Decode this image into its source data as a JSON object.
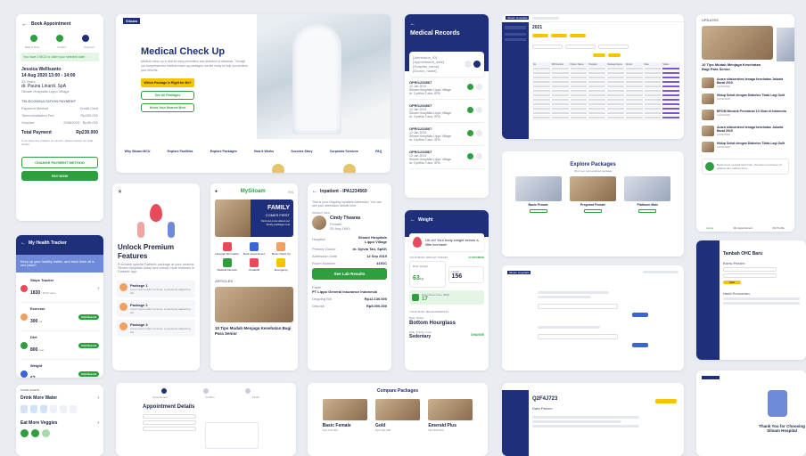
{
  "booking": {
    "title": "Book Appointment",
    "steps": [
      "Date & Time",
      "Confirm",
      "Payment"
    ],
    "banner": "You have 2 MCU to claim your selected date",
    "patient": "Jessica Wellisanto",
    "date": "14 Aug 2020 13:00 - 14:00",
    "age": "25 Years",
    "doctor": "dr. Pauna Linardi, SpA",
    "hospital": "Siloam Hospitals Lippo Village",
    "section": "TELECONSULTATION PAYMENT",
    "payment_method_label": "Payment Method",
    "payment_method": "Credit Card",
    "fee_label": "Teleconsultation Fee",
    "fee": "Rp200.000",
    "voucher_label": "Voucher",
    "voucher": "20062020 - Rp30.000",
    "total_label": "Total Payment",
    "total": "Rp230.000",
    "note": "If you have any problem or concern, please contact our Help Center",
    "change_btn": "CHANGE PAYMENT METHOD",
    "pay_btn": "PAY NOW"
  },
  "mcu": {
    "nav_items": [
      "MCU Home",
      "Login",
      "English"
    ],
    "title": "Medical Check Up",
    "desc": "Medical check-up is vital for early prevention and detection of diseases. Through our comprehensive medical check-up packages, we are ready to help you achieve your best life.",
    "btn_find": "Which Package is Right for Me?",
    "btn_all": "See All Packages",
    "btn_nearest": "Know Your Nearest Best",
    "footer_links": [
      "Why Siloam MCU",
      "Explore Facilities",
      "Explore Packages",
      "How it Works",
      "Success Story",
      "Corporate Services",
      "FAQ"
    ]
  },
  "records": {
    "title": "Medical Records",
    "header_lines": [
      "{Admission_ID}",
      "{Appointment_date}",
      "{Hospital_name}",
      "{Doctor_name}"
    ],
    "items": [
      {
        "id": "OPR/1234567",
        "date": "12 Jan 2019",
        "hospital": "Siloam Hospitals Lippo Village",
        "doctor": "dr. Cynthia Tulus, SPA"
      },
      {
        "id": "OPR/1234567",
        "date": "12 Jan 2019",
        "hospital": "Siloam Hospitals Lippo Village",
        "doctor": "dr. Cynthia Tulus, SPA"
      },
      {
        "id": "OPR/1234567",
        "date": "12 Jan 2019",
        "hospital": "Siloam Hospitals Lippo Village",
        "doctor": "dr. Cynthia Tulus, SPA"
      },
      {
        "id": "OPR/1234567",
        "date": "12 Jan 2019",
        "hospital": "Siloam Hospitals Lippo Village",
        "doctor": "dr. Cynthia Tulus, SPA"
      }
    ]
  },
  "dashboard": {
    "logo": "Siloam Hospitals",
    "year": "2021",
    "columns": [
      "No",
      "MR Number",
      "Patient Name",
      "Hospital",
      "Package Name",
      "Doctor",
      "Date",
      "Status"
    ],
    "rows": 12
  },
  "news": {
    "header": "UPDATES",
    "featured": "10 Tips Mudah Menjaga Kesehatan Bagi Para Senior",
    "featured2": "10 Ti Para",
    "items": [
      {
        "title": "Acara silaturrahmi tenaga kesehatan Jakarta Barat 2019",
        "date": "12/02/2020"
      },
      {
        "title": "Hidup Sehat dengan Diabetes Tidak Lagi Sulit",
        "date": "12/02/2020"
      },
      {
        "title": "BPOM Menarik Peredaran 10 Obat di Indonesia",
        "date": "12/02/2020"
      },
      {
        "title": "Acara silaturrahmi tenaga kesehatan Jakarta Barat 2019",
        "date": "12/02/2020"
      },
      {
        "title": "Hidup Sehat dengan Diabetes Tidak Lagi Sulit",
        "date": "12/02/2020"
      }
    ],
    "promo": "Berita kami menjadi lebih baik. Temukan pembaruan di aplikasi dan website kami.",
    "tabs": [
      "Home",
      "My Appointment",
      "My Profile"
    ]
  },
  "premium": {
    "title": "Unlock Premium Features",
    "desc": "Purchase special Diabetic package at your nearest Siloam hospitals today and unlock more features in Diabetic App.",
    "packages": [
      {
        "name": "Package 1",
        "desc": "Lorem ipsum dolor sit amet, consectetur adipiscing elit."
      },
      {
        "name": "Package 2",
        "desc": "Lorem ipsum dolor sit amet, consectetur adipiscing elit."
      },
      {
        "name": "Package 3",
        "desc": "Lorem ipsum dolor sit amet, consectetur adipiscing elit."
      }
    ]
  },
  "mysiloam": {
    "logo": "MySiloam",
    "lang": "EN",
    "banner_title": "FAMILY",
    "banner_sub": "COMES FIRST",
    "banner_desc": "Find out more about our family package now",
    "menu": [
      "Hospital Information",
      "Book Appointment",
      "Book Check Up",
      "Medical Records",
      "OneEHR",
      "Emergency"
    ],
    "section": "ARTICLES",
    "article": "10 Tips Mudah Menjaga Kesehatan Bagi Para Senior"
  },
  "inpatient": {
    "title": "Inpatient - IPA1234569",
    "desc": "This is your Ongoing Inpatient Admission. You can see your admission details here.",
    "patient_label": "PATIENT INFO",
    "patient_name": "Cindy Thearas",
    "gender": "Female",
    "dob": "25 Aug 1993",
    "hospital_label": "Hospital",
    "hospital": "Siloam Hospitals Lippo Village",
    "doctor_label": "Primary Doctor",
    "doctor": "dr. Sylvia Tan, SpKK",
    "adm_label": "Admission Date",
    "adm": "12 Sep 2019",
    "room_label": "Room Number",
    "room": "4151C",
    "btn": "See Lab Results",
    "payer_label": "Payer",
    "payer": "PT Lippo General Insurance Indonesia",
    "ongoing_label": "Ongoing Bill",
    "ongoing": "Rp12.136.000",
    "deposit_label": "Deposit",
    "deposit": "Rp5.000.000"
  },
  "weight": {
    "title": "Weight",
    "alert": "Uh oh! Your body weight seems a little increase!",
    "section": "YOUR BODY WEIGHT TARGET",
    "customize": "CUSTOMIZE",
    "current_label": "Body Weight",
    "current": "63",
    "unit": "kg",
    "height_label": "Height",
    "height": "156",
    "bmi_label": "Body Mass Index (BMI)",
    "bmi": "17",
    "section2": "YOUR BODY MEASUREMENTS",
    "shape_label": "Body Shape",
    "shape": "Bottom Hourglass",
    "activity_label": "Daily Activity Level",
    "activity": "Sedentary",
    "change": "CHANGE"
  },
  "tracker": {
    "title": "My Health Tracker",
    "banner": "Keep up your healthy habits, and track them all in one place!",
    "items": [
      {
        "name": "Steps Tracker",
        "value": "1830",
        "unit": "/ 6000 steps",
        "btn": ""
      },
      {
        "name": "Exercise",
        "value": "300",
        "unit": "cal",
        "btn": "Add Record"
      },
      {
        "name": "Diet",
        "value": "800",
        "unit": "kcal",
        "btn": "Add Record"
      },
      {
        "name": "Weight",
        "value": "62",
        "unit": "kg",
        "btn": "Add Record"
      }
    ],
    "habits_label": "GOOD HABITS",
    "drink": "Drink More Water",
    "veg": "Eat More Veggies"
  },
  "appointment": {
    "steps": [
      "Appointment",
      "Confirm",
      "Finish"
    ],
    "title": "Appointment Details"
  },
  "compare": {
    "title": "Compare Packages",
    "packages": [
      {
        "name": "Basic Female",
        "price": "Rp1.100.000"
      },
      {
        "name": "Gold",
        "price": "Rp2.100.000"
      },
      {
        "name": "Emerald Plus",
        "price": "Rp3.800.000"
      }
    ]
  },
  "explore": {
    "title": "Explore Packages",
    "sub": "Find your personalized package",
    "packages": [
      "Basic Female",
      "Pregnant Female",
      "Platinum Male"
    ]
  },
  "chat": {
    "logo": "Siloam Hospitals"
  },
  "detail": {
    "id": "Q2F4J723",
    "title": "Data Pasien"
  },
  "booking_form": {
    "title": "Tambah OHC Baru",
    "sub": "Kartu Pasien",
    "section": "Hasil Pencarian",
    "btn": "Cari"
  },
  "thanks": {
    "title": "Thank You for Choosing Siloam Hospital"
  },
  "colors": {
    "navy": "#1f2f7a",
    "green": "#2e9e3e",
    "yellow": "#f7c400",
    "blue": "#3a64d8"
  }
}
